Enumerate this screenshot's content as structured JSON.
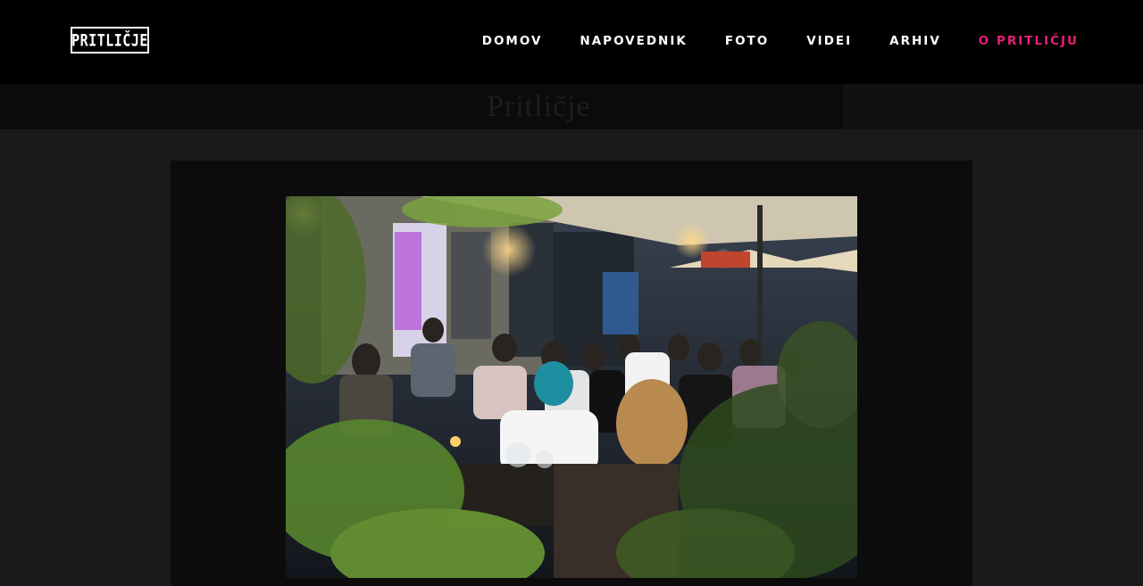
{
  "header": {
    "logo_text": "PRITLIČJE",
    "nav": [
      {
        "label": "DOMOV",
        "active": false
      },
      {
        "label": "NAPOVEDNIK",
        "active": false
      },
      {
        "label": "FOTO",
        "active": false
      },
      {
        "label": "VIDEI",
        "active": false
      },
      {
        "label": "ARHIV",
        "active": false
      },
      {
        "label": "O PRITLIČJU",
        "active": true
      }
    ],
    "accent_color": "#e91e7a"
  },
  "subheader": {
    "faded_title": "Pritličje"
  },
  "main": {
    "photo_label": "terrace-crowd-night-photo"
  }
}
